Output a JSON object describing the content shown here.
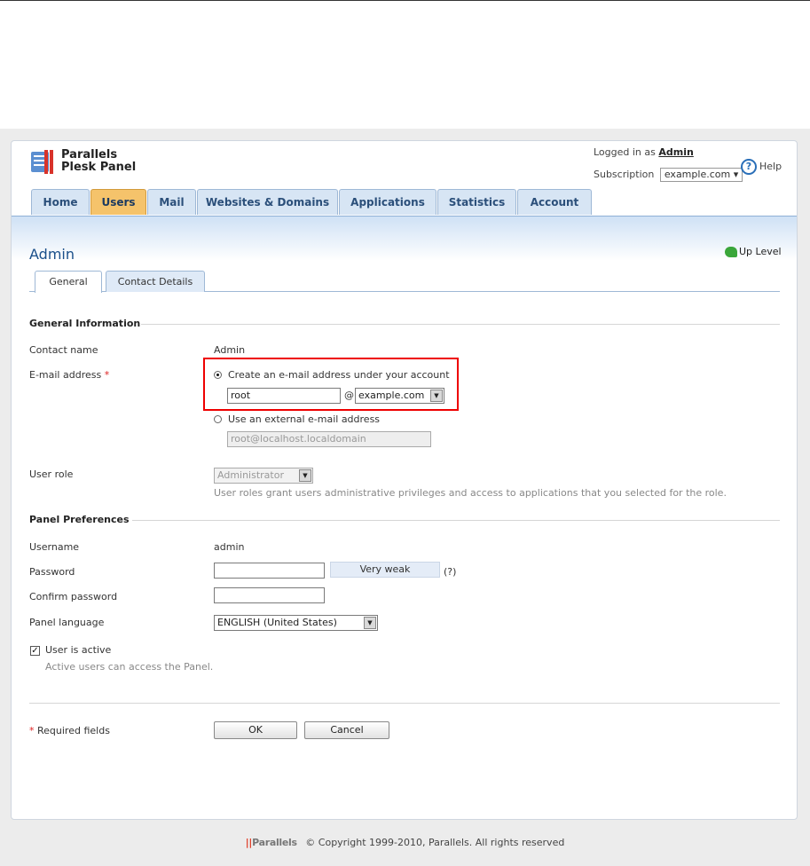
{
  "brand": {
    "line1": "Parallels",
    "line2": "Plesk Panel"
  },
  "header": {
    "logged_in_prefix": "Logged in as",
    "user": "Admin",
    "subscription_label": "Subscription",
    "subscription_value": "example.com",
    "help_label": "Help"
  },
  "tabs": [
    "Home",
    "Users",
    "Mail",
    "Websites & Domains",
    "Applications",
    "Statistics",
    "Account"
  ],
  "active_tab": "Users",
  "page": {
    "title": "Admin",
    "up_level": "Up Level"
  },
  "subtabs": [
    "General",
    "Contact Details"
  ],
  "general": {
    "section_title": "General Information",
    "contact_name_label": "Contact name",
    "contact_name_value": "Admin",
    "email_label": "E-mail address",
    "required_mark": "*",
    "email_option_internal": "Create an e-mail address under your account",
    "email_local_part": "root",
    "at_sign": "@",
    "email_domain": "example.com",
    "email_option_external": "Use an external e-mail address",
    "external_email_value": "root@localhost.localdomain",
    "user_role_label": "User role",
    "user_role_value": "Administrator",
    "user_role_hint": "User roles grant users administrative privileges and access to applications that you selected for the role."
  },
  "preferences": {
    "section_title": "Panel Preferences",
    "username_label": "Username",
    "username_value": "admin",
    "password_label": "Password",
    "password_strength": "Very weak",
    "password_help": "(?)",
    "confirm_password_label": "Confirm password",
    "language_label": "Panel language",
    "language_value": "ENGLISH (United States)",
    "user_active_label": "User is active",
    "user_active_checked": true,
    "user_active_hint": "Active users can access the Panel."
  },
  "form": {
    "required_fields_label": "Required fields",
    "ok_label": "OK",
    "cancel_label": "Cancel"
  },
  "footer": {
    "logo_text": "Parallels",
    "copyright": "© Copyright 1999-2010, Parallels. All rights reserved"
  }
}
